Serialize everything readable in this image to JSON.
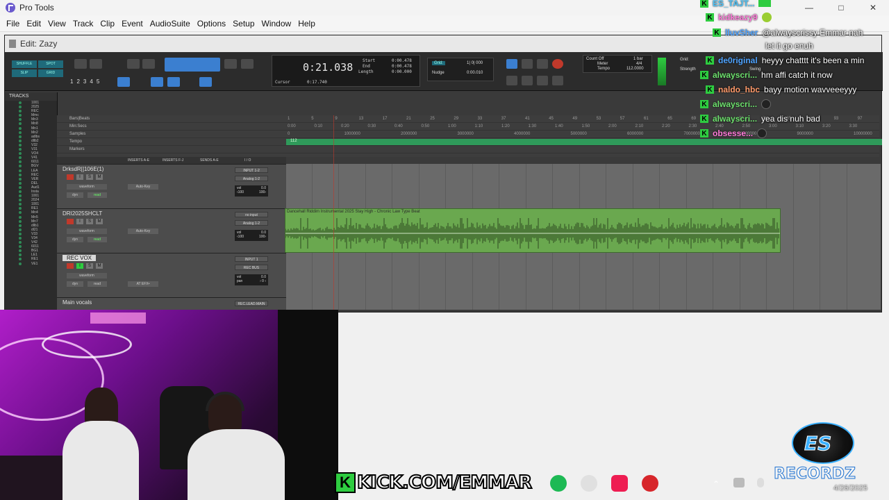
{
  "window": {
    "title": "Pro Tools",
    "edit_title": "Edit: Zazy"
  },
  "menu": [
    "File",
    "Edit",
    "View",
    "Track",
    "Clip",
    "Event",
    "AudioSuite",
    "Options",
    "Setup",
    "Window",
    "Help"
  ],
  "toolbar": {
    "modes": [
      "SHUFFLE",
      "SPOT",
      "SLIP",
      "GRID"
    ],
    "zoom_presets": [
      "1",
      "2",
      "3",
      "4",
      "5"
    ],
    "main_counter": "0:21.038",
    "start_label": "Start",
    "start_value": "0:00.478",
    "end_label": "End",
    "end_value": "0:00.478",
    "length_label": "Length",
    "length_value": "0:00.000",
    "cursor_label": "Cursor",
    "cursor_value": "0:17.740",
    "grid_value": "1| 0| 000",
    "nudge_label": "Nudge",
    "nudge_value": "0:00.010",
    "count_off": "Count Off",
    "meter_label": "Meter",
    "meter_value": "4/4",
    "tempo_label": "Tempo",
    "tempo_value": "112.0000",
    "bar_label": "1 bar",
    "grid_label": "Grid:",
    "strength_label": "Strength",
    "swing_label": "Swing"
  },
  "tracks_list": {
    "header": "TRACKS",
    "items": [
      "1001",
      "2025",
      "REC",
      "Mmc",
      "Mn3",
      "Mn8",
      "Mn1",
      "Mn2",
      "adlbs",
      "dllb2",
      "V32",
      "V31",
      "VO4",
      "V41",
      "6011",
      "BGV",
      "LEA",
      "REC",
      "VER",
      "DEL",
      "Aud1",
      "Insta",
      "1001",
      "2024",
      "1001",
      "RE1",
      "Mn4",
      "Mn5",
      "Mn7",
      "dllb1",
      "dl21",
      "V33",
      "V34",
      "V42",
      "6011",
      "BG1",
      "LE1",
      "RE1",
      "VE1"
    ]
  },
  "rulers": {
    "labels": [
      "Bars|Beats",
      "Min:Secs",
      "Samples",
      "Tempo",
      "Markers"
    ],
    "bars": [
      "1",
      "5",
      "9",
      "13",
      "17",
      "21",
      "25",
      "29",
      "33",
      "37",
      "41",
      "45",
      "49",
      "53",
      "57",
      "61",
      "65",
      "69",
      "73",
      "77",
      "81",
      "85",
      "89",
      "93",
      "97"
    ],
    "minsecs": [
      "0:00",
      "0:10",
      "0:20",
      "0:30",
      "0:40",
      "0:50",
      "1:00",
      "1:10",
      "1:20",
      "1:30",
      "1:40",
      "1:50",
      "2:00",
      "2:10",
      "2:20",
      "2:30",
      "2:40",
      "2:50",
      "3:00",
      "3:10",
      "3:20",
      "3:30"
    ],
    "samples": [
      "0",
      "1000000",
      "2000000",
      "3000000",
      "4000000",
      "5000000",
      "6000000",
      "7000000",
      "8000000",
      "9000000",
      "10000000"
    ],
    "tempo_marker": "112"
  },
  "track_columns": {
    "inserts_ae": "INSERTS A-E",
    "inserts_fj": "INSERTS F-J",
    "sends_ae": "SENDS A-E",
    "io": "I / O"
  },
  "tracks": [
    {
      "name": "DrksdR|]106E(1)",
      "view": "waveform",
      "dyn": "dyn",
      "mode": "read",
      "insert": "Auto-Key",
      "input": "INPUT 1-2",
      "output": "Analog 1-2",
      "vol_label": "vol",
      "vol": "0.0",
      "pan_l": "‹100",
      "pan_r": "100›"
    },
    {
      "name": "DRI2025SHCLT",
      "view": "waveform",
      "dyn": "dyn",
      "mode": "read",
      "insert": "Auto-Key",
      "input": "no input",
      "output": "Analog 1-2",
      "vol_label": "vol",
      "vol": "0.0",
      "pan_l": "‹100",
      "pan_r": "100›"
    },
    {
      "name": "REC VOX",
      "view": "waveform",
      "dyn": "dyn",
      "mode": "read",
      "insert": "AT EFX•",
      "input": "INPUT 1",
      "output": "REC BUS",
      "vol_label": "vol",
      "vol": "0.0",
      "pan_label": "pan",
      "pan": "› 0 ‹"
    },
    {
      "name": "Main vocals",
      "input": "REC.LEAD.MAIN"
    }
  ],
  "clip": {
    "name": "Dancehall Riddim Instrumental 2025 Stay High - Chronic Law Type Beat"
  },
  "chat": [
    {
      "user": "ES_TAJT...",
      "user_color": "#4fc3f7",
      "msg": ""
    },
    {
      "user": "kidkeazy9",
      "user_color": "#ff7ad9",
      "msg": ""
    },
    {
      "user": "lluvSher",
      "user_color": "#4fa3ff",
      "msg": "@alwayscrissy Emmar nah"
    },
    {
      "user": "",
      "user_color": "#ffffff",
      "msg": "let it go enuh"
    },
    {
      "user": "de0riginal",
      "user_color": "#4fa3ff",
      "msg": "heyyy chatttt it's been a min"
    },
    {
      "user": "alwayscri...",
      "user_color": "#6ee26e",
      "msg": "hm affi catch it now"
    },
    {
      "user": "naldo_hbc",
      "user_color": "#ff9a6a",
      "msg": "bayy motion wavveeeyyy"
    },
    {
      "user": "alwayscri...",
      "user_color": "#6ee26e",
      "msg": ""
    },
    {
      "user": "alwayscri...",
      "user_color": "#6ee26e",
      "msg": "yea dis nuh bad"
    },
    {
      "user": "obsesse...",
      "user_color": "#ff7ad9",
      "msg": ""
    }
  ],
  "overlay": {
    "kick_badge": "K",
    "kick_url": "KICK.COM/EMMAR",
    "logo_es": "ES",
    "logo_text": "RECORDZ",
    "date": "4/26/2025"
  },
  "colors": {
    "kick_green": "#2ecc40",
    "clip_green": "#6aa84f",
    "tempo_green": "#2f9a5a",
    "rec_red": "#c0392b"
  }
}
